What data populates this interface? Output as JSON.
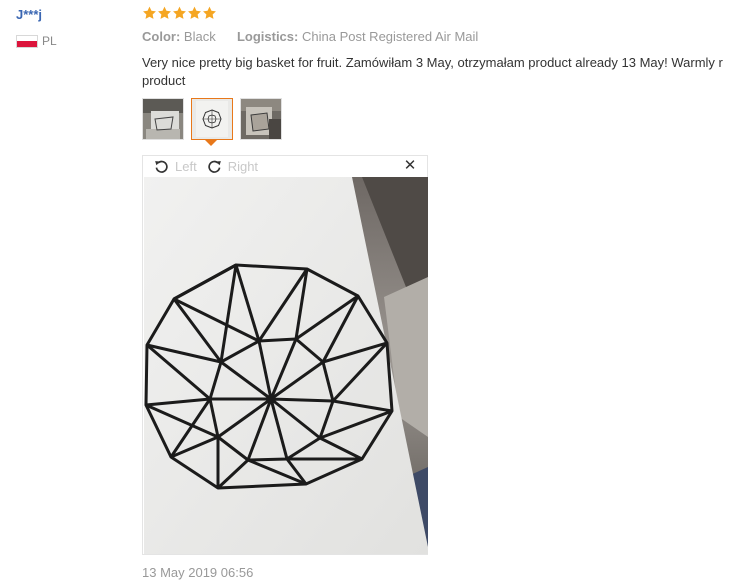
{
  "review": {
    "user_name": "J***j",
    "country_code": "PL",
    "flag_icon": "poland-flag-icon",
    "rating": 5,
    "rating_max": 5,
    "star_color": "#f5a623",
    "color_label": "Color:",
    "color_value": "Black",
    "logistics_label": "Logistics:",
    "logistics_value": "China Post Registered Air Mail",
    "text_line1": "Very nice pretty big basket for fruit. Zamówiłam 3 May, otrzymałam product already 13 May! Warmly r",
    "text_line2": "product",
    "date": "13 May 2019 06:56"
  },
  "thumbnails": [
    {
      "icon": "photo-thumbnail-1",
      "selected": false
    },
    {
      "icon": "photo-thumbnail-2",
      "selected": true
    },
    {
      "icon": "photo-thumbnail-3",
      "selected": false
    }
  ],
  "viewer": {
    "rotate_left_label": "Left",
    "rotate_right_label": "Right",
    "close_icon": "close-icon",
    "rotate_left_icon": "rotate-left-icon",
    "rotate_right_icon": "rotate-right-icon"
  },
  "colors": {
    "accent": "#e8781a",
    "user_link": "#3a66b2",
    "muted_text": "#999999"
  }
}
